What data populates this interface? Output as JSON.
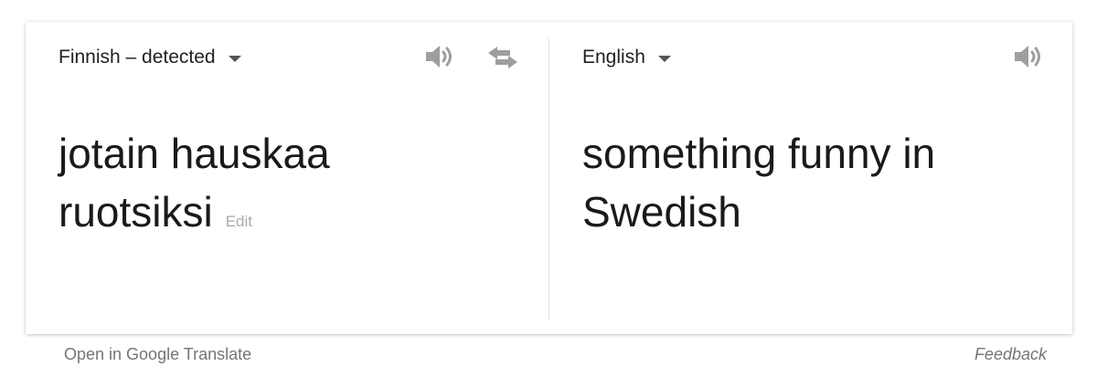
{
  "source": {
    "language_label": "Finnish – detected",
    "text_line1": "jotain hauskaa",
    "text_line2": "ruotsiksi",
    "edit_label": "Edit"
  },
  "target": {
    "language_label": "English",
    "text_line1": "something funny in",
    "text_line2": "Swedish"
  },
  "footer": {
    "open_link": "Open in Google Translate",
    "feedback_link": "Feedback"
  },
  "icons": {
    "source_speaker": "speaker-icon",
    "swap": "swap-languages-icon",
    "target_speaker": "speaker-icon"
  },
  "colors": {
    "text": "#1a1a1a",
    "icon": "#9e9e9e",
    "muted": "#757575"
  }
}
